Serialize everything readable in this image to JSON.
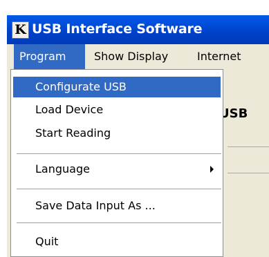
{
  "window": {
    "logo_letter": "K",
    "title": "USB Interface Software"
  },
  "menubar": {
    "items": [
      {
        "label": "Program"
      },
      {
        "label": "Show Display"
      },
      {
        "label": "Internet"
      }
    ]
  },
  "content": {
    "partial_label": "USB"
  },
  "dropdown": {
    "items": [
      {
        "label": "Configurate USB"
      },
      {
        "label": "Load Device"
      },
      {
        "label": "Start Reading"
      },
      {
        "label": "Language"
      },
      {
        "label": "Save Data Input As ..."
      },
      {
        "label": "Quit"
      }
    ]
  },
  "colors": {
    "title_bar": "#0040c8",
    "highlight": "#316ac5",
    "menu_background": "#ece9d8"
  }
}
